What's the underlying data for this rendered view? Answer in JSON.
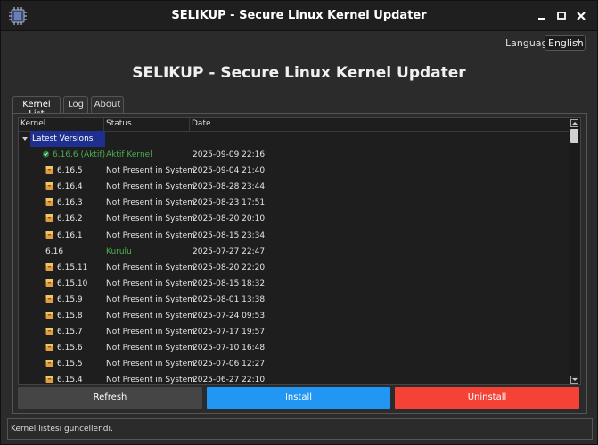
{
  "window": {
    "title": "SELIKUP - Secure Linux Kernel Updater"
  },
  "language": {
    "label": "Language:",
    "selected": "English"
  },
  "app_title": "SELIKUP - Secure Linux Kernel Updater",
  "tabs": [
    {
      "label": "Kernel List",
      "active": true
    },
    {
      "label": "Log",
      "active": false
    },
    {
      "label": "About",
      "active": false
    }
  ],
  "table": {
    "columns": [
      "Kernel",
      "Status",
      "Date"
    ],
    "group": "Latest Versions",
    "rows": [
      {
        "kernel": "6.16.6 (Aktif)",
        "status": "Aktif Kernel",
        "date": "2025-09-09 22:16",
        "icon": "check-icon"
      },
      {
        "kernel": "6.16.5",
        "status": "Not Present in System",
        "date": "2025-09-04 21:40",
        "icon": "package-icon"
      },
      {
        "kernel": "6.16.4",
        "status": "Not Present in System",
        "date": "2025-08-28 23:44",
        "icon": "package-icon"
      },
      {
        "kernel": "6.16.3",
        "status": "Not Present in System",
        "date": "2025-08-23 17:51",
        "icon": "package-icon"
      },
      {
        "kernel": "6.16.2",
        "status": "Not Present in System",
        "date": "2025-08-20 20:10",
        "icon": "package-icon"
      },
      {
        "kernel": "6.16.1",
        "status": "Not Present in System",
        "date": "2025-08-15 23:34",
        "icon": "package-icon"
      },
      {
        "kernel": "6.16",
        "status": "Kurulu",
        "date": "2025-07-27 22:47",
        "icon": "none"
      },
      {
        "kernel": "6.15.11",
        "status": "Not Present in System",
        "date": "2025-08-20 22:20",
        "icon": "package-icon"
      },
      {
        "kernel": "6.15.10",
        "status": "Not Present in System",
        "date": "2025-08-15 18:32",
        "icon": "package-icon"
      },
      {
        "kernel": "6.15.9",
        "status": "Not Present in System",
        "date": "2025-08-01 13:38",
        "icon": "package-icon"
      },
      {
        "kernel": "6.15.8",
        "status": "Not Present in System",
        "date": "2025-07-24 09:53",
        "icon": "package-icon"
      },
      {
        "kernel": "6.15.7",
        "status": "Not Present in System",
        "date": "2025-07-17 19:57",
        "icon": "package-icon"
      },
      {
        "kernel": "6.15.6",
        "status": "Not Present in System",
        "date": "2025-07-10 16:48",
        "icon": "package-icon"
      },
      {
        "kernel": "6.15.5",
        "status": "Not Present in System",
        "date": "2025-07-06 12:27",
        "icon": "package-icon"
      },
      {
        "kernel": "6.15.4",
        "status": "Not Present in System",
        "date": "2025-06-27 22:10",
        "icon": "package-icon"
      }
    ]
  },
  "buttons": {
    "refresh": "Refresh",
    "install": "Install",
    "uninstall": "Uninstall"
  },
  "colors": {
    "install": "#2196f3",
    "uninstall": "#f44336",
    "refresh": "#454545",
    "active_green": "#4caf50",
    "selection": "#1f2f8f"
  },
  "status_bar": "Kernel listesi güncellendi."
}
